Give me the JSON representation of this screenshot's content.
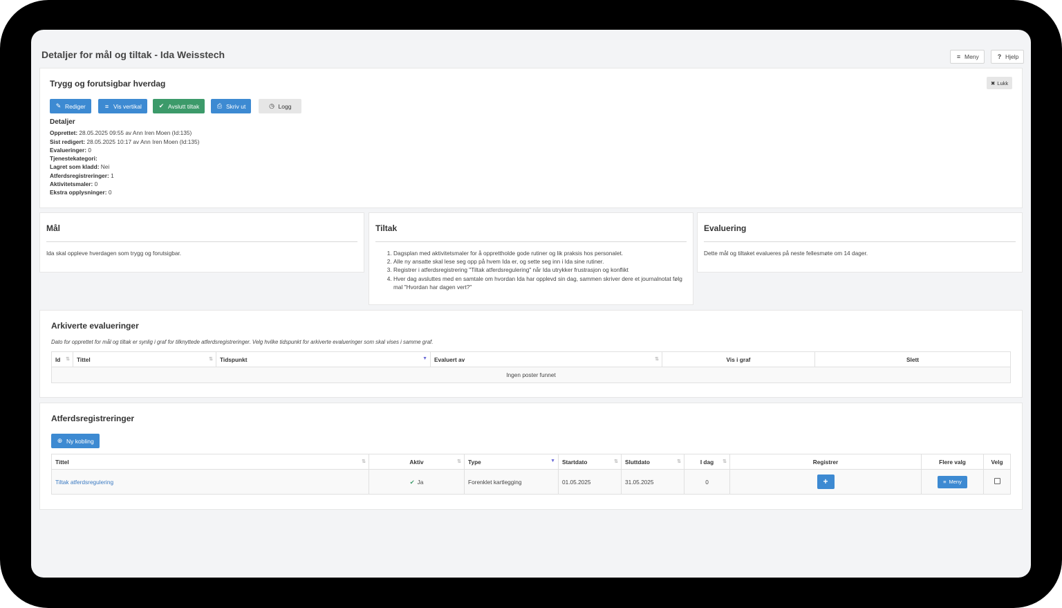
{
  "page": {
    "title": "Detaljer for mål og tiltak - Ida Weisstech"
  },
  "top_buttons": {
    "menu": "Meny",
    "help": "Hjelp"
  },
  "goal_panel": {
    "title": "Trygg og forutsigbar hverdag",
    "close": "Lukk",
    "buttons": {
      "edit": "Rediger",
      "vertical": "Vis vertikal",
      "finish": "Avslutt tiltak",
      "print": "Skriv ut",
      "log": "Logg"
    },
    "details_heading": "Detaljer",
    "details": [
      {
        "label": "Opprettet:",
        "value": "28.05.2025 09:55 av Ann Iren Moen (Id:135)"
      },
      {
        "label": "Sist redigert:",
        "value": "28.05.2025 10:17 av Ann Iren Moen (Id:135)"
      },
      {
        "label": "Evalueringer:",
        "value": "0"
      },
      {
        "label": "Tjenestekategori:",
        "value": ""
      },
      {
        "label": "Lagret som kladd:",
        "value": "Nei"
      },
      {
        "label": "Atferdsregistreringer:",
        "value": "1"
      },
      {
        "label": "Aktivitetsmaler:",
        "value": "0"
      },
      {
        "label": "Ekstra opplysninger:",
        "value": "0"
      }
    ]
  },
  "mal": {
    "title": "Mål",
    "text": "Ida skal oppleve hverdagen som trygg og forutsigbar."
  },
  "tiltak": {
    "title": "Tiltak",
    "items": [
      "Dagsplan med aktivitetsmaler for å opprettholde gode rutiner og lik praksis hos personalet.",
      "Alle ny ansatte skal lese seg opp på hvem Ida er, og sette seg inn i Ida sine rutiner.",
      "Registrer i atferdsregistrering \"Tiltak atferdsregulering\" når Ida utrykker frustrasjon og konflikt",
      "Hver dag avsluttes med en samtale om hvordan Ida har opplevd sin dag, sammen skriver dere et journalnotat følg mal \"Hvordan har dagen vert?\""
    ]
  },
  "evaluering": {
    "title": "Evaluering",
    "text": "Dette mål og tiltaket evalueres på neste fellesmøte om 14 dager."
  },
  "arkiverte": {
    "title": "Arkiverte evalueringer",
    "note": "Dato for opprettet for mål og tiltak er synlig i graf for tilknyttede atferdsregistreringer. Velg hvilke tidspunkt for arkiverte evalueringer som skal vises i samme graf.",
    "columns": [
      "Id",
      "Tittel",
      "Tidspunkt",
      "Evaluert av",
      "Vis i graf",
      "Slett"
    ],
    "empty": "Ingen poster funnet"
  },
  "atferd": {
    "title": "Atferdsregistreringer",
    "new_button": "Ny kobling",
    "columns": [
      "Tittel",
      "Aktiv",
      "Type",
      "Startdato",
      "Sluttdato",
      "I dag",
      "Registrer",
      "Flere valg",
      "Velg"
    ],
    "rows": [
      {
        "title": "Tiltak atferdsregulering",
        "active": "Ja",
        "type": "Forenklet kartlegging",
        "start": "01.05.2025",
        "end": "31.05.2025",
        "today": "0",
        "menu": "Meny"
      }
    ]
  },
  "colors": {
    "primary": "#3d8ad2",
    "success": "#3c9a6a",
    "background": "#f3f4f6"
  }
}
